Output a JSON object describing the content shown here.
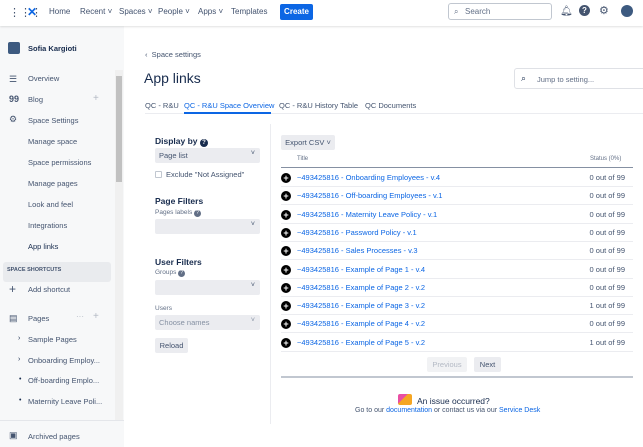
{
  "topnav": {
    "items": [
      "Home",
      "Recent",
      "Spaces",
      "People",
      "Apps",
      "Templates"
    ],
    "create": "Create",
    "search_placeholder": "Search"
  },
  "sidebar": {
    "user": "Sofia Kargioti",
    "items": [
      {
        "label": "Overview",
        "icon": "overview-icon"
      },
      {
        "label": "Blog",
        "icon": "quote-icon"
      },
      {
        "label": "Space Settings",
        "icon": "gear-icon"
      }
    ],
    "settings": [
      "Manage space",
      "Space permissions",
      "Manage pages",
      "Look and feel",
      "Integrations",
      "App links"
    ],
    "shortcuts_heading": "SPACE SHORTCUTS",
    "add_shortcut": "Add shortcut",
    "pages": "Pages",
    "page_tree": [
      "Sample Pages",
      "Onboarding Employ...",
      "Off-boarding Emplo...",
      "Maternity Leave Poli..."
    ],
    "archived": "Archived pages"
  },
  "main": {
    "breadcrumb": "Space settings",
    "title": "App links",
    "jump_placeholder": "Jump to setting...",
    "tabs": [
      "QC - R&U",
      "QC - R&U Space Overview",
      "QC - R&U History Table",
      "QC Documents"
    ],
    "active_tab": 1
  },
  "filters": {
    "display_by": "Display by",
    "display_value": "Page list",
    "exclude": "Exclude \"Not Assigned\"",
    "page_filters": "Page Filters",
    "pages_labels": "Pages labels",
    "user_filters": "User Filters",
    "groups": "Groups",
    "users": "Users",
    "users_placeholder": "Choose names",
    "reload": "Reload"
  },
  "table": {
    "export": "Export CSV",
    "col_title": "Title",
    "col_status": "Status (0%)",
    "rows": [
      {
        "title": "~493425816 - Onboarding Employees - v.4",
        "status": "0 out of 99"
      },
      {
        "title": "~493425816 - Off-boarding Employees - v.1",
        "status": "0 out of 99"
      },
      {
        "title": "~493425816 - Maternity Leave Policy - v.1",
        "status": "0 out of 99"
      },
      {
        "title": "~493425816 - Password Policy - v.1",
        "status": "0 out of 99"
      },
      {
        "title": "~493425816 - Sales Processes - v.3",
        "status": "0 out of 99"
      },
      {
        "title": "~493425816 - Example of Page 1 - v.4",
        "status": "0 out of 99"
      },
      {
        "title": "~493425816 - Example of Page 2 - v.2",
        "status": "0 out of 99"
      },
      {
        "title": "~493425816 - Example of Page 3 - v.2",
        "status": "1 out of 99"
      },
      {
        "title": "~493425816 - Example of Page 4 - v.2",
        "status": "0 out of 99"
      },
      {
        "title": "~493425816 - Example of Page 5 - v.2",
        "status": "1 out of 99"
      }
    ],
    "previous": "Previous",
    "next": "Next"
  },
  "issue": {
    "title": "An issue occurred?",
    "text1": "Go to our",
    "link1": "documentation",
    "text2": "or contact us via our",
    "link2": "Service Desk"
  }
}
